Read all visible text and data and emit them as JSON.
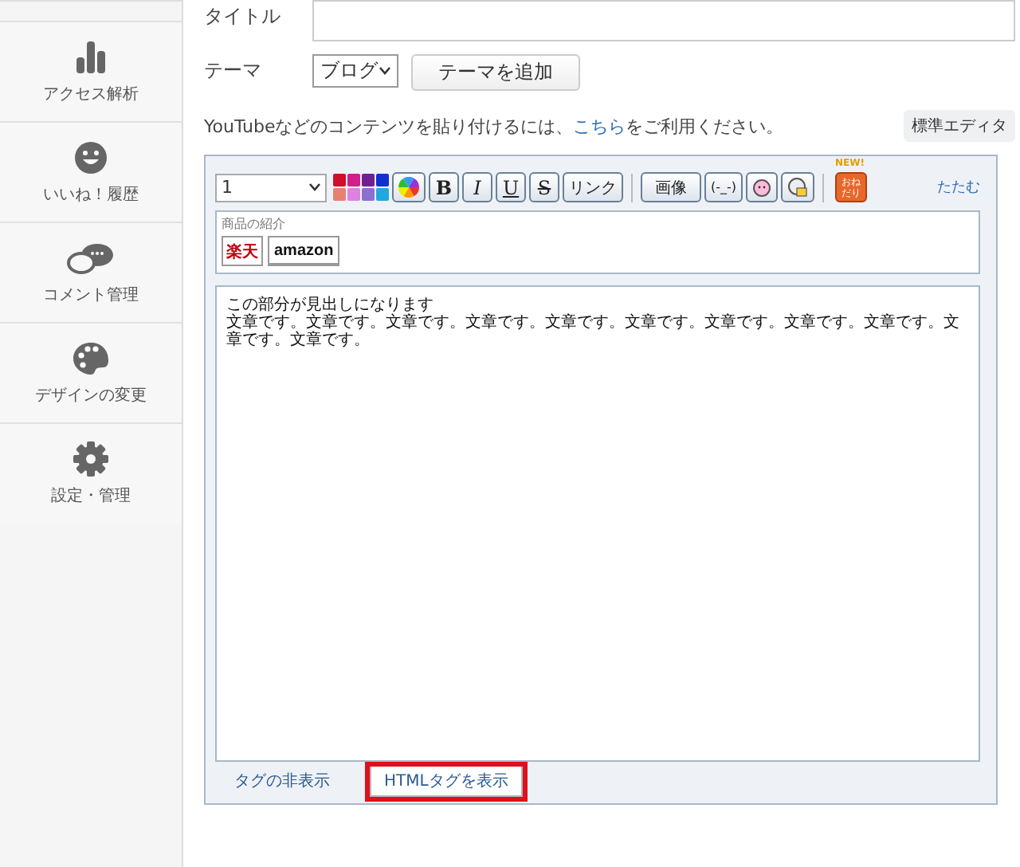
{
  "sidebar": {
    "items": [
      {
        "label": "アクセス解析"
      },
      {
        "label": "いいね！履歴"
      },
      {
        "label": "コメント管理"
      },
      {
        "label": "デザインの変更"
      },
      {
        "label": "設定・管理"
      }
    ]
  },
  "form": {
    "title_label": "タイトル",
    "theme_label": "テーマ",
    "theme_value": "ブログ",
    "add_theme_button": "テーマを追加",
    "notice": {
      "before": "YouTubeなどのコンテンツを貼り付けるには、",
      "link": "こちら",
      "after": "をご利用ください。"
    },
    "standard_editor_button": "標準エディタ"
  },
  "editor": {
    "font_size": "1",
    "swatches": [
      {
        "color": "#d0102a"
      },
      {
        "color": "#d0208c"
      },
      {
        "color": "#702090"
      },
      {
        "color": "#1030d0"
      },
      {
        "color": "#e88070"
      },
      {
        "color": "#e080e0"
      },
      {
        "color": "#8a70d0"
      },
      {
        "color": "#20a8e0"
      }
    ],
    "format_buttons": [
      {
        "kind": "bold",
        "label": "B"
      },
      {
        "kind": "italic",
        "label": "I"
      },
      {
        "kind": "underline",
        "label": "U"
      },
      {
        "kind": "strike",
        "label": "S"
      },
      {
        "kind": "plain",
        "label": "リンク"
      }
    ],
    "image_button": "画像",
    "emoticon": "(-_-)",
    "gift_badge": "NEW!",
    "gift_lines": [
      "おね",
      "だり"
    ],
    "collapse_link": "たたむ",
    "product_panel": {
      "title": "商品の紹介",
      "rakuten_label": "楽天",
      "amazon_label": "amazon"
    },
    "content": {
      "heading": "この部分が見出しになります",
      "body": "文章です。文章です。文章です。文章です。文章です。文章です。文章です。文章です。文章です。文章です。文章です。"
    },
    "tabs": [
      {
        "label": "タグの非表示",
        "selected": false,
        "highlighted": false
      },
      {
        "label": "HTMLタグを表示",
        "selected": true,
        "highlighted": true
      }
    ]
  }
}
